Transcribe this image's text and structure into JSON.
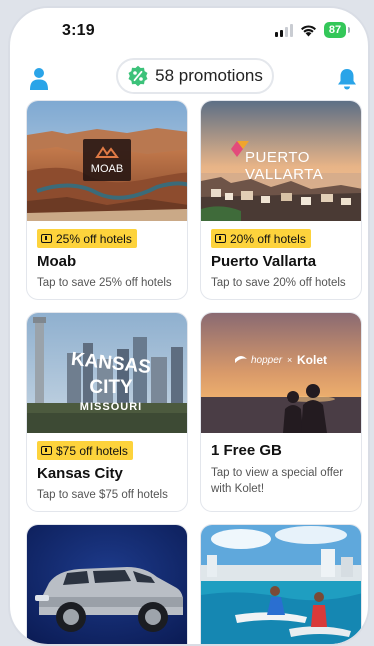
{
  "status_bar": {
    "time": "3:19",
    "battery": "87"
  },
  "header": {
    "promotions_label": "58 promotions"
  },
  "cards": [
    {
      "tag": "25% off hotels",
      "title": "Moab",
      "subtitle": "Tap to save 25% off hotels",
      "image_label": "MOAB"
    },
    {
      "tag": "20% off hotels",
      "title": "Puerto Vallarta",
      "subtitle": "Tap to save 20% off hotels",
      "image_label_1": "PUERTO",
      "image_label_2": "VALLARTA"
    },
    {
      "tag": "$75 off hotels",
      "title": "Kansas City",
      "subtitle": "Tap to save $75 off hotels",
      "image_label_1": "KANSAS",
      "image_label_2": "CITY",
      "image_label_3": "MISSOURI"
    },
    {
      "title": "1 Free GB",
      "subtitle": "Tap to view a special offer with Kolet!",
      "image_label_1": "hopper",
      "image_label_2": "×",
      "image_label_3": "Kolet"
    }
  ],
  "colors": {
    "accent": "#2aa4e8",
    "tag_bg": "#fdd33c",
    "promo_badge": "#3cc27a"
  },
  "icons": [
    "user-icon",
    "bell-icon",
    "promo-badge-icon",
    "wifi-icon",
    "signal-icon",
    "hotel-tag-icon"
  ]
}
